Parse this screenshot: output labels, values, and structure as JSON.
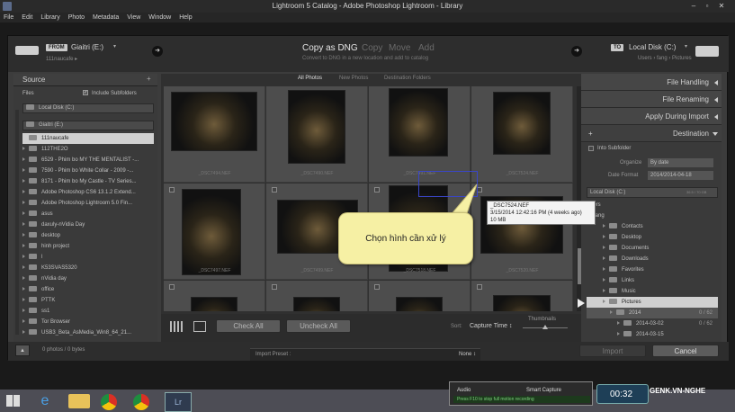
{
  "window": {
    "title": "Lightroom 5 Catalog - Adobe Photoshop Lightroom - Library"
  },
  "menu": [
    "File",
    "Edit",
    "Library",
    "Photo",
    "Metadata",
    "View",
    "Window",
    "Help"
  ],
  "topbar": {
    "from_chip": "FROM",
    "source_name": "Giaitri (E:)",
    "source_path": "111naucafe ▸",
    "modes": [
      "Copy as DNG",
      "Copy",
      "Move",
      "Add"
    ],
    "subtitle": "Convert to DNG in a new location and add to catalog",
    "to_chip": "TO",
    "dest_name": "Local Disk (C:)",
    "dest_path": "Users › fang › Pictures"
  },
  "left": {
    "header": "Source",
    "files_label": "Files",
    "include_sub": "Include Subfolders",
    "local_disk": "Local Disk (C:)",
    "giaitri": "Giaitri (E:)",
    "folders": [
      "111naucafe",
      "112THE2O",
      "6529 - Phim bo MY THE MENTALIST -...",
      "7590 - Phim bo White Collar - 2009 -...",
      "8171 - Phim bo My Castle - TV Series...",
      "Adobe Photoshop CS6 13.1.2 Extend...",
      "Adobe Photoshop Lightroom 5.0 Fin...",
      "asus",
      "daxuly-nVidia Day",
      "desktop",
      "hinh project",
      "l",
      "K53SVAS5320",
      "nVidia day",
      "office",
      "PTTK",
      "ss1",
      "Tor Browser",
      "USB3_Beta_AsMedia_Win8_64_21..."
    ],
    "photo_count": "0 photos / 0 bytes"
  },
  "center": {
    "tabs": [
      "All Photos",
      "New Photos",
      "Destination Folders"
    ],
    "filenames": [
      "_DSC7494.NEF",
      "_DSC7490.NEF",
      "_DSC7491.NEF",
      "_DSC7524.NEF",
      "_DSC7497.NEF",
      "_DSC7499.NEF",
      "_DSC7518.NEF",
      "_DSC7520.NEF"
    ],
    "check_all": "Check All",
    "uncheck_all": "Uncheck All",
    "sort_label": "Sort:",
    "sort_value": "Capture Time ↕",
    "thumbnails_label": "Thumbnails"
  },
  "tooltip": {
    "line1": "_DSC7524.NEF",
    "line2": "3/15/2014 12:42:16 PM (4 weeks ago)",
    "line3": "10 MB"
  },
  "callout": {
    "text": "Chọn hình cần xử lý"
  },
  "right": {
    "panels": [
      "File Handling",
      "File Renaming",
      "Apply During Import"
    ],
    "destination": "Destination",
    "into_sub": "Into Subfolder",
    "organize_label": "Organize",
    "organize_value": "By date",
    "date_format_label": "Date Format",
    "date_format_value": "2014/2014-04-18",
    "local_disk": "Local Disk (C:)",
    "local_disk_size": "36.5 / 70 GB",
    "tree": [
      "Users",
      "fang",
      "Contacts",
      "Desktop",
      "Documents",
      "Downloads",
      "Favorites",
      "Links",
      "Music",
      "Pictures",
      "2014",
      "2014-03-02",
      "2014-03-15"
    ],
    "counts": [
      "0 / 62",
      "0 / 62"
    ],
    "import_btn": "Import",
    "cancel_btn": "Cancel"
  },
  "bottom": {
    "preset_label": "Import Preset :",
    "preset_value": "None ↕"
  },
  "recorder": {
    "audio": "Audio",
    "smart_capture": "Smart Capture",
    "hint": "Press F10 to stop full motion recording",
    "timer": "00:32"
  },
  "watermark": "GENK.VN-NGHE",
  "colors": {
    "accent_green": "#2e7d32",
    "callout": "#f6f0a4",
    "selection": "#3a46c8"
  }
}
